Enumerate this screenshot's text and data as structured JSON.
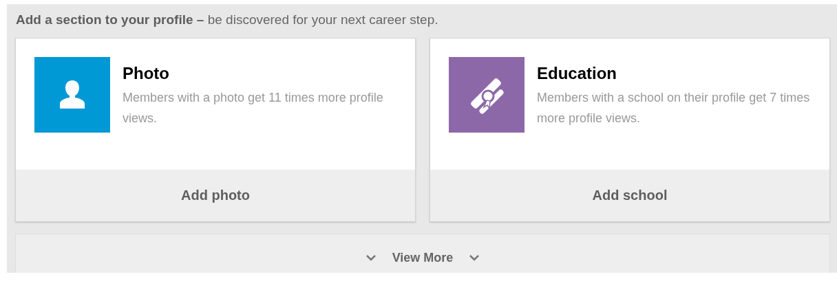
{
  "heading": "**Add a section to your profile –** be discovered for your next career step.",
  "cards": [
    {
      "kind": "photo",
      "color": "#0099d6",
      "title": "Photo",
      "description": "Members with a photo get 11 times more profile views.",
      "action": "Add photo"
    },
    {
      "kind": "education",
      "color": "#8c68a9",
      "title": "Education",
      "description": "Members with a school on their profile get 7 times more profile views.",
      "action": "Add school"
    }
  ],
  "view_more": "View More"
}
